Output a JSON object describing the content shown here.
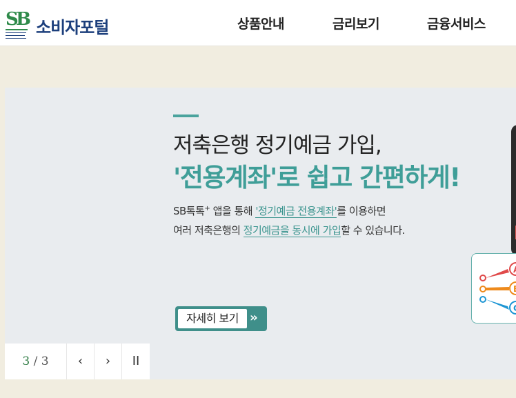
{
  "header": {
    "logo_text": "소비자포털",
    "nav": [
      "상품안내",
      "금리보기",
      "금융서비스"
    ]
  },
  "slide": {
    "title_line1": "저축은행 정기예금 가입,",
    "title_line2": "'전용계좌'로 쉽고 간편하게!",
    "desc1_pre": "SB톡톡",
    "desc1_sup": "+",
    "desc1_mid": " 앱을 통해 ",
    "desc1_hl": "'정기예금 전용계좌'",
    "desc1_post": "를 이용하면",
    "desc2_pre": "여러 저축은행의 ",
    "desc2_hl": "정기예금을 동시에 가입",
    "desc2_post": "할 수 있습니다.",
    "more_label": "자세히 보기",
    "more_arrow": "››",
    "card_labels": [
      "A",
      "B",
      "C"
    ]
  },
  "controls": {
    "current": "3",
    "separator": " / ",
    "total": "3",
    "prev_icon": "‹",
    "next_icon": "›",
    "pause_icon": "II"
  },
  "colors": {
    "accent": "#3f9e98",
    "navy": "#1c3f7c",
    "background": "#f1ede0"
  }
}
